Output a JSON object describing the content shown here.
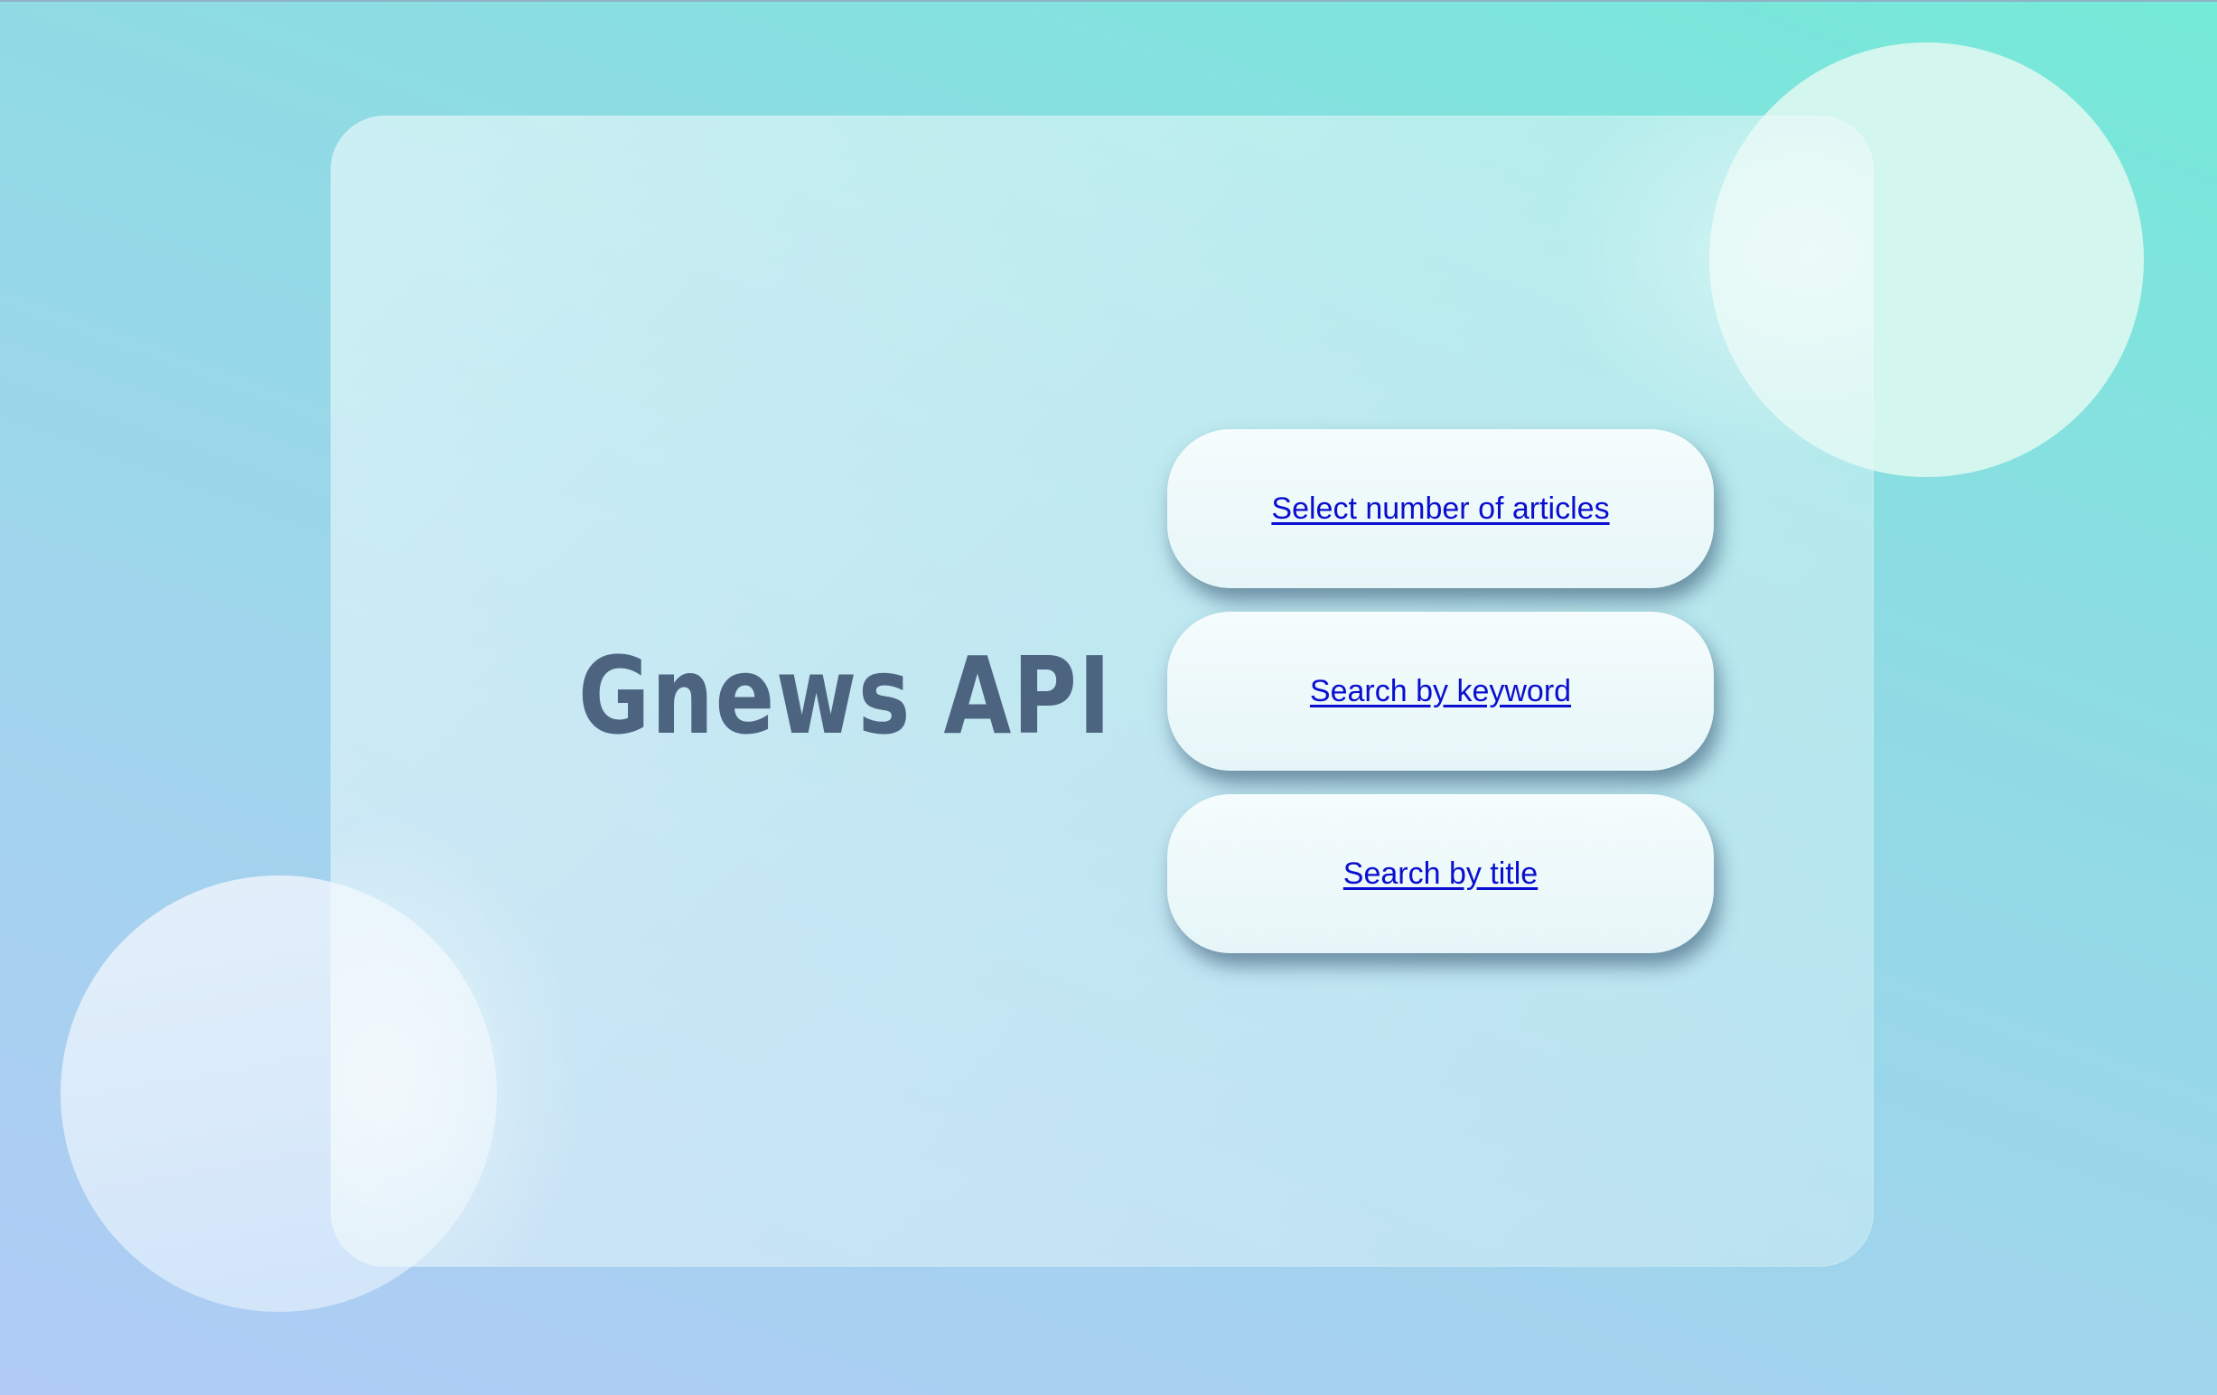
{
  "page": {
    "title": "Gnews API"
  },
  "menu": {
    "items": [
      {
        "label": "Select number of articles"
      },
      {
        "label": "Search by keyword"
      },
      {
        "label": "Search by title"
      }
    ]
  },
  "colors": {
    "title_text": "#4d6481",
    "link_text": "#0a0fcf",
    "background_start": "#b0cbf5",
    "background_end": "#74ead8",
    "button_bg": "#f5fcfd"
  }
}
